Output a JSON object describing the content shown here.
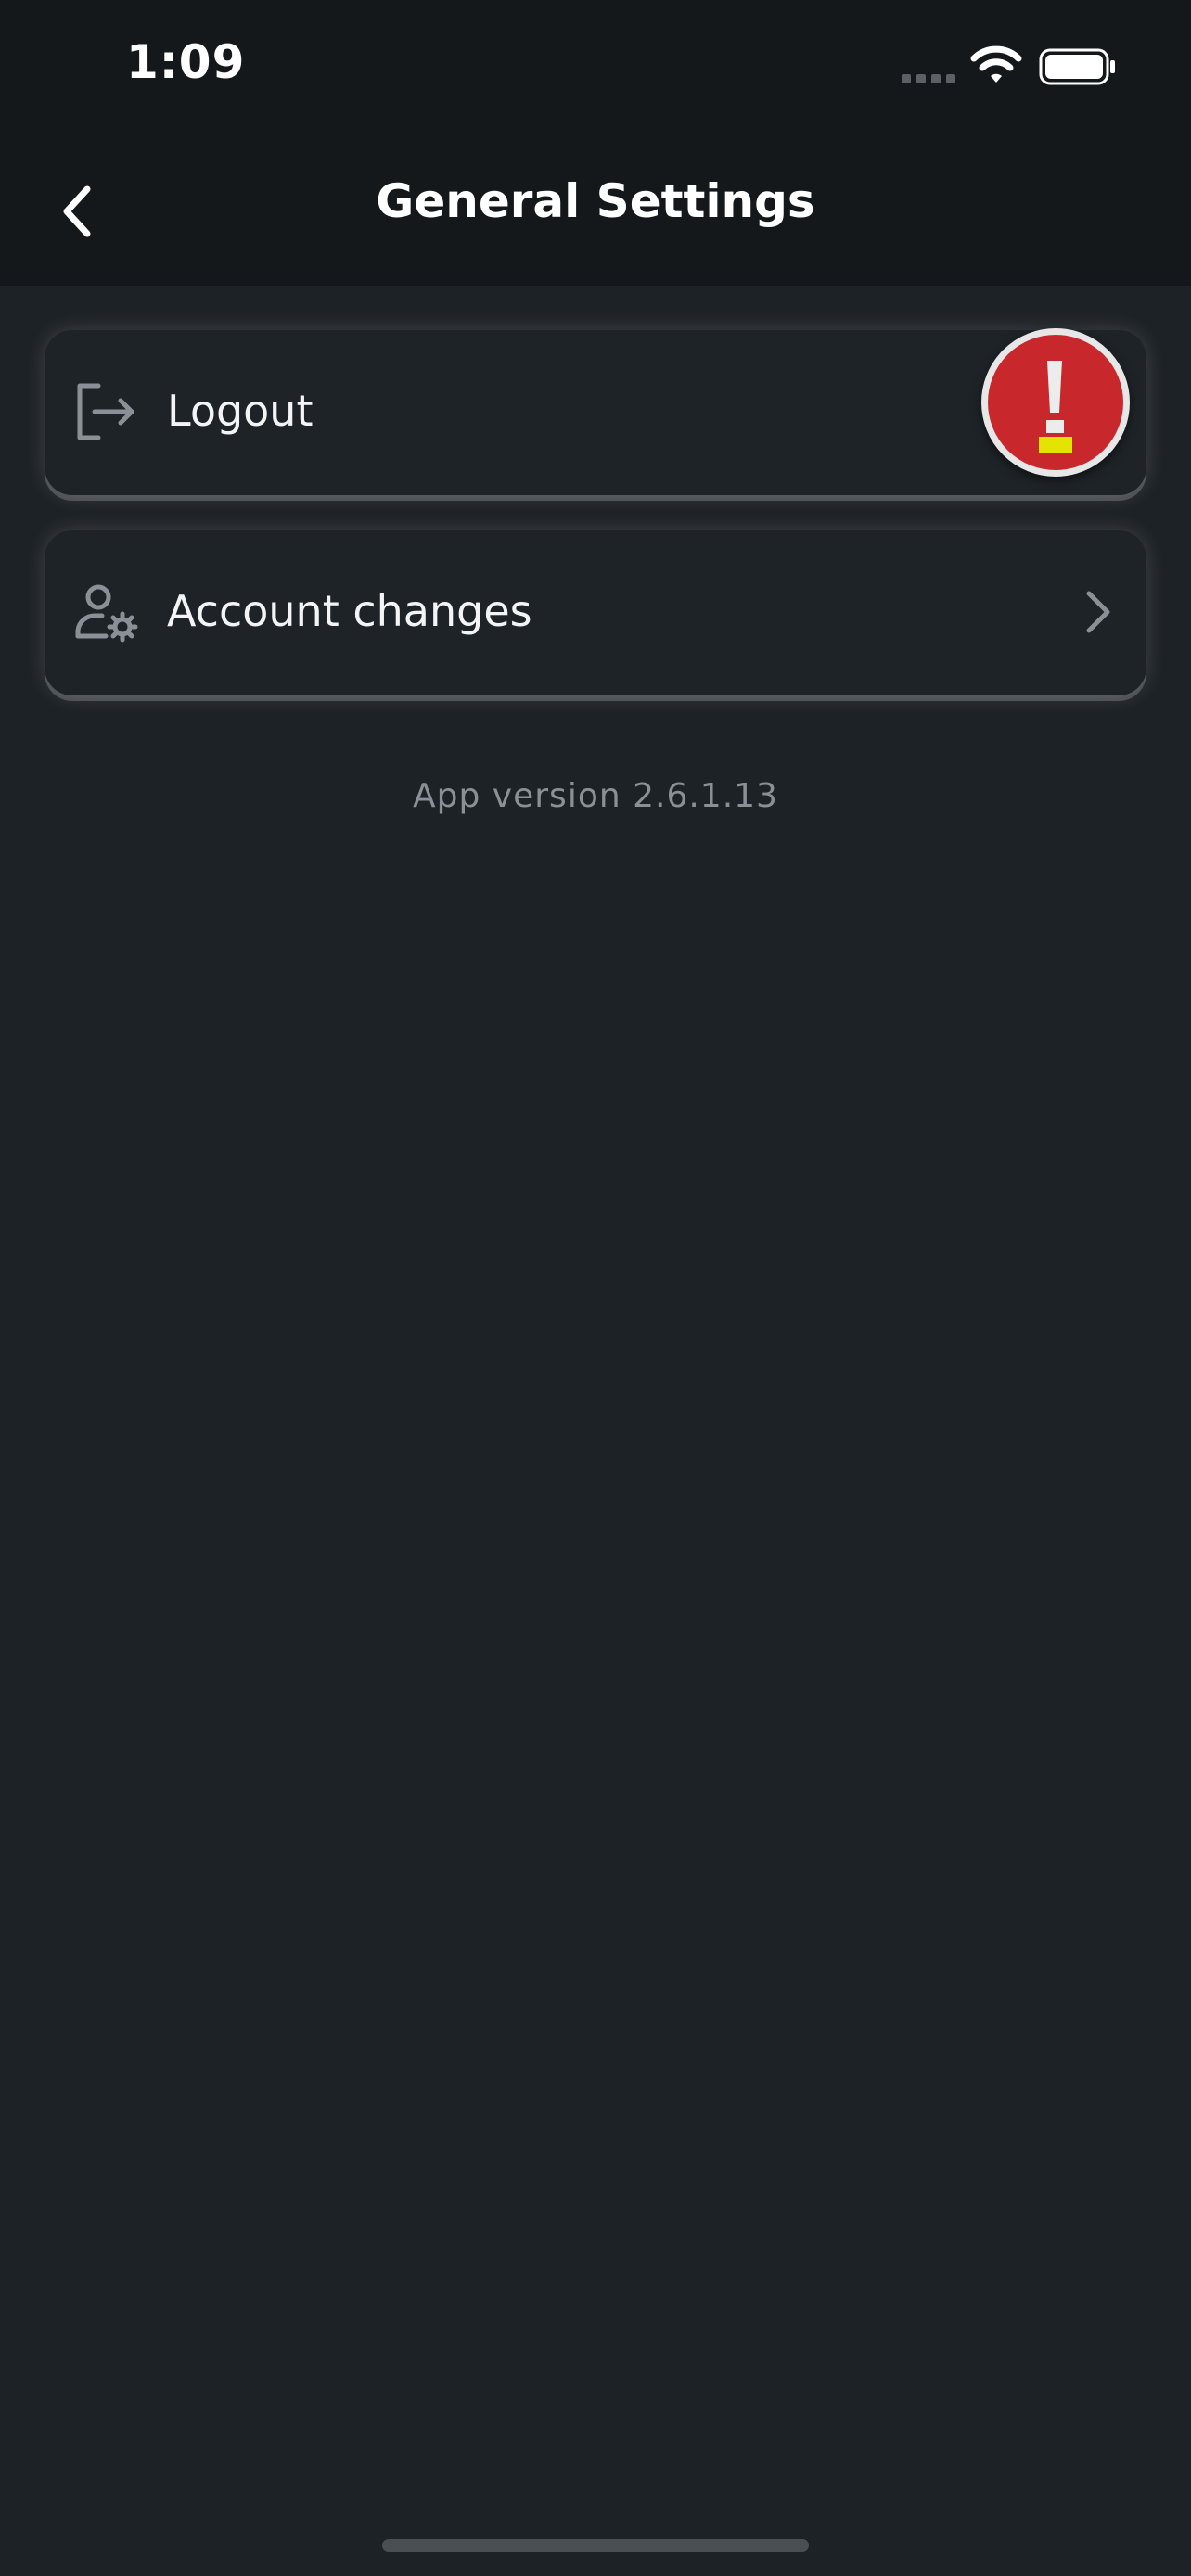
{
  "status_bar": {
    "time": "1:09",
    "icons": [
      "signal-dots-icon",
      "wifi-icon",
      "battery-icon"
    ]
  },
  "header": {
    "title": "General Settings",
    "back_icon": "chevron-left-icon"
  },
  "menu": {
    "items": [
      {
        "label": "Logout",
        "icon": "logout-icon",
        "trailing_icon": "chevron-right-icon"
      },
      {
        "label": "Account changes",
        "icon": "user-settings-icon",
        "trailing_icon": "chevron-right-icon"
      }
    ]
  },
  "footer": {
    "version": "App version 2.6.1.13"
  },
  "alert_badge": {
    "icon": "exclamation-icon"
  },
  "colors": {
    "background": "#1d2226",
    "header_background": "#14181b",
    "card_background": "#1e2327",
    "icon_gray": "#8a9096",
    "alert_red": "#c8282c",
    "alert_yellow": "#e3e300"
  }
}
